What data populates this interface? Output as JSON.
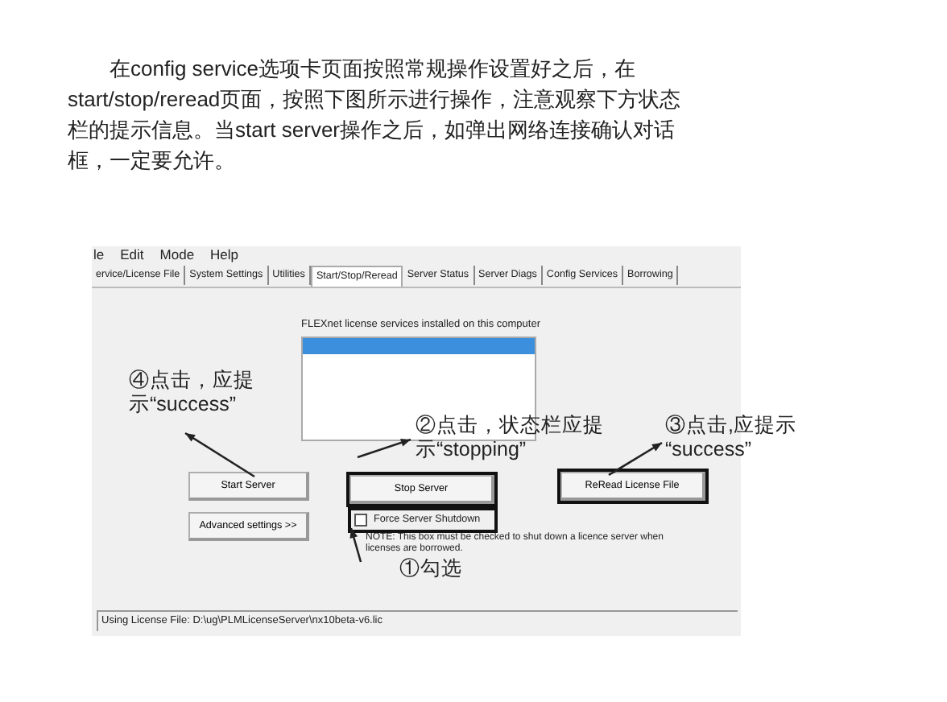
{
  "article": {
    "paragraph": "在config service选项卡页面按照常规操作设置好之后，在start/stop/reread页面，按照下图所示进行操作，注意观察下方状态栏的提示信息。当start server操作之后，如弹出网络连接确认对话框，一定要允许。"
  },
  "window": {
    "menu": [
      "le",
      "Edit",
      "Mode",
      "Help"
    ],
    "tabs": [
      {
        "label": "ervice/License File",
        "selected": false
      },
      {
        "label": "System Settings",
        "selected": false
      },
      {
        "label": "Utilities",
        "selected": false
      },
      {
        "label": "Start/Stop/Reread",
        "selected": true
      },
      {
        "label": "Server Status",
        "selected": false
      },
      {
        "label": "Server Diags",
        "selected": false
      },
      {
        "label": "Config Services",
        "selected": false
      },
      {
        "label": "Borrowing",
        "selected": false
      }
    ],
    "services_label": "FLEXnet license services installed on this computer",
    "services": [
      {
        "selected": true
      }
    ],
    "start_button": {
      "label": "Start Server",
      "highlighted": false
    },
    "advanced_button": {
      "label": "Advanced settings >>",
      "highlighted": false
    },
    "stop_button": {
      "label": "Stop Server",
      "highlighted": true
    },
    "reread_button": {
      "label": "ReRead License File",
      "highlighted": true
    },
    "force_shutdown": {
      "label": "Force Server Shutdown",
      "checked": false,
      "highlighted": true
    },
    "note": "NOTE:  This box must be checked to shut down a licence server when licenses are borrowed.",
    "status_bar": "Using License File:  D:\\ug\\PLMLicenseServer\\nx10beta-v6.lic"
  },
  "annotations": [
    {
      "lines": [
        "④点击，应提",
        "示“success”"
      ]
    },
    {
      "lines": [
        "②点击，状态栏应提",
        "示“stopping”"
      ]
    },
    {
      "lines": [
        "③点击,应提示",
        "“success”"
      ]
    },
    {
      "lines": [
        "①勾选"
      ]
    }
  ]
}
